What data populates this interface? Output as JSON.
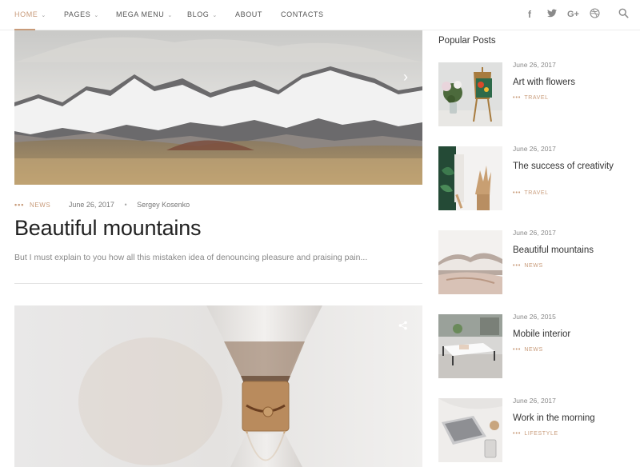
{
  "nav": {
    "items": [
      {
        "label": "HOME",
        "has_menu": true
      },
      {
        "label": "PAGES",
        "has_menu": true
      },
      {
        "label": "MEGA MENU",
        "has_menu": true
      },
      {
        "label": "BLOG",
        "has_menu": true
      },
      {
        "label": "ABOUT",
        "has_menu": false
      },
      {
        "label": "CONTACTS",
        "has_menu": false
      }
    ],
    "social_icons": [
      "facebook-icon",
      "twitter-icon",
      "google-plus-icon",
      "dribbble-icon"
    ],
    "search_icon": "search-icon"
  },
  "main": {
    "post1": {
      "category": "NEWS",
      "date": "June 26, 2017",
      "author": "Sergey Kosenko",
      "title": "Beautiful mountains",
      "excerpt": "But I must explain to you how all this mistaken idea of denouncing pleasure and praising pain..."
    }
  },
  "sidebar": {
    "title": "Popular Posts",
    "posts": [
      {
        "date": "June 26, 2017",
        "title": "Art with flowers",
        "category": "TRAVEL"
      },
      {
        "date": "June 26, 2017",
        "title": "The success of creativity",
        "category": "TRAVEL"
      },
      {
        "date": "June 26, 2017",
        "title": "Beautiful mountains",
        "category": "NEWS"
      },
      {
        "date": "June 26, 2015",
        "title": "Mobile interior",
        "category": "NEWS"
      },
      {
        "date": "June 26, 2017",
        "title": "Work in the morning",
        "category": "LIFESTYLE"
      }
    ]
  },
  "colors": {
    "accent": "#c89b7a",
    "text": "#333333",
    "muted": "#888888"
  }
}
